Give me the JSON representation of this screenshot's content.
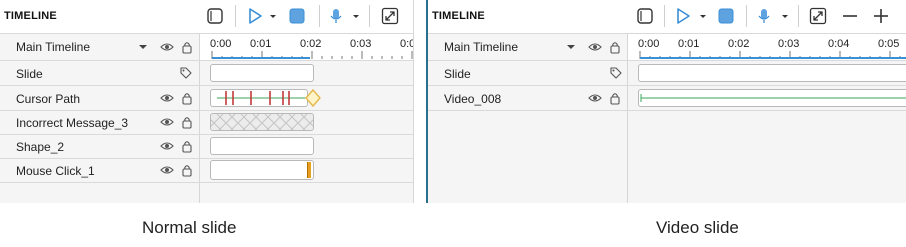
{
  "left": {
    "title": "TIMELINE",
    "main_timeline": "Main Timeline",
    "ruler": [
      "0:00",
      "0:01",
      "0:02",
      "0:03",
      "0:0"
    ],
    "layers": [
      {
        "name": "Slide"
      },
      {
        "name": "Cursor Path"
      },
      {
        "name": "Incorrect Message_3"
      },
      {
        "name": "Shape_2"
      },
      {
        "name": "Mouse Click_1"
      }
    ],
    "caption": "Normal slide"
  },
  "right": {
    "title": "TIMELINE",
    "main_timeline": "Main Timeline",
    "ruler": [
      "0:00",
      "0:01",
      "0:02",
      "0:03",
      "0:04",
      "0:05"
    ],
    "layers": [
      {
        "name": "Slide"
      },
      {
        "name": "Video_008"
      }
    ],
    "caption": "Video slide"
  },
  "colors": {
    "accent": "#3b8fd6",
    "cursor_marker": "#c23b3b",
    "diamond": "#e4b94a",
    "mouse_click": "#e6a020",
    "video_line": "#3aa65a"
  }
}
